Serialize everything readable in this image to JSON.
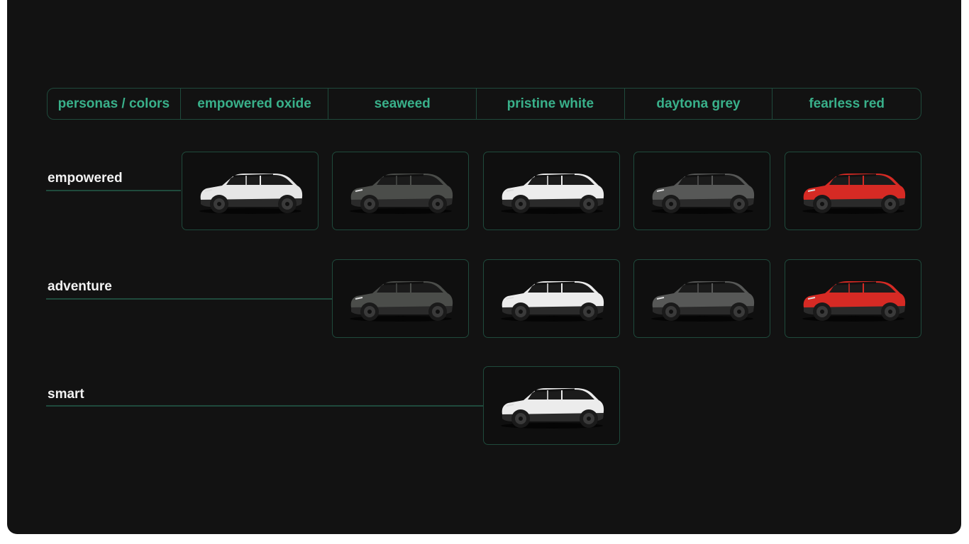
{
  "header": {
    "corner_label": "personas / colors",
    "colors": [
      {
        "label": "empowered oxide",
        "body": "#e6e6e6",
        "lower": "#2a2a2a"
      },
      {
        "label": "seaweed",
        "body": "#4b4d4a",
        "lower": "#2a2a2a"
      },
      {
        "label": "pristine white",
        "body": "#ececec",
        "lower": "#2a2a2a"
      },
      {
        "label": "daytona grey",
        "body": "#575857",
        "lower": "#2a2a2a"
      },
      {
        "label": "fearless red",
        "body": "#d62a24",
        "lower": "#2a2a2a"
      }
    ]
  },
  "personas": [
    {
      "label": "empowered",
      "available": [
        0,
        1,
        2,
        3,
        4
      ]
    },
    {
      "label": "adventure",
      "available": [
        1,
        2,
        3,
        4
      ]
    },
    {
      "label": "smart",
      "available": [
        2
      ]
    }
  ],
  "colors_theme": {
    "accent": "#39b08a",
    "border": "#1f4a3c",
    "background": "#121212"
  }
}
